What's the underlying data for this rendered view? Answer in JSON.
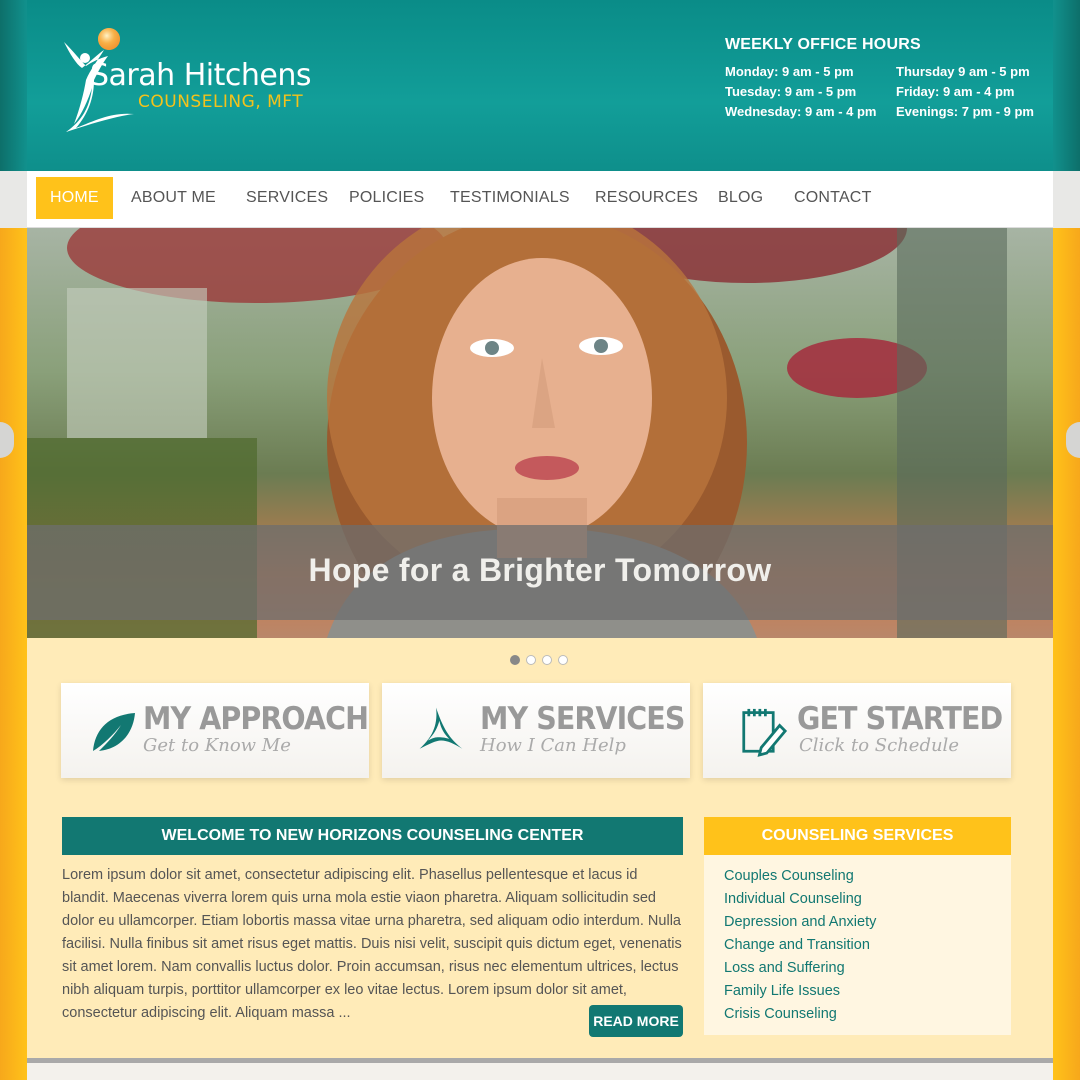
{
  "header": {
    "logo_name": "Sarah Hitchens",
    "logo_sub": "COUNSELING, MFT",
    "hours_title": "WEEKLY OFFICE HOURS",
    "hours": [
      "Monday: 9 am - 5 pm",
      "Thursday 9 am - 5 pm",
      "Tuesday: 9 am - 5 pm",
      "Friday: 9 am - 4 pm",
      "Wednesday: 9 am - 4 pm",
      "Evenings: 7 pm - 9 pm"
    ]
  },
  "nav": {
    "items": [
      "HOME",
      "ABOUT ME",
      "SERVICES",
      "POLICIES",
      "TESTIMONIALS",
      "RESOURCES",
      "BLOG",
      "CONTACT"
    ],
    "active": "HOME"
  },
  "hero": {
    "caption": "Hope for a Brighter Tomorrow",
    "slides": 4,
    "current_slide": 1
  },
  "promos": [
    {
      "title": "MY APPROACH",
      "subtitle": "Get to Know Me",
      "icon": "leaf-icon"
    },
    {
      "title": "MY SERVICES",
      "subtitle": "How I Can Help",
      "icon": "tripod-icon"
    },
    {
      "title": "GET STARTED",
      "subtitle": "Click to Schedule",
      "icon": "notepad-pencil-icon"
    }
  ],
  "welcome": {
    "title": "WELCOME TO NEW HORIZONS COUNSELING CENTER",
    "body": "Lorem ipsum dolor sit amet, consectetur adipiscing elit. Phasellus pellentesque et lacus id blandit. Maecenas viverra lorem quis urna mola estie viaon pharetra. Aliquam sollicitudin sed dolor eu ullamcorper. Etiam lobortis massa vitae urna pharetra, sed aliquam odio interdum. Nulla facilisi. Nulla finibus sit amet risus eget mattis. Duis nisi velit, suscipit quis dictum eget, venenatis sit amet lorem. Nam convallis luctus dolor. Proin accumsan, risus nec elementum ultrices, lectus nibh aliquam turpis, porttitor ullamcorper ex leo vitae lectus. Lorem ipsum dolor sit amet, consectetur adipiscing elit. Aliquam massa ...",
    "read_more": "READ MORE"
  },
  "services": {
    "title": "COUNSELING SERVICES",
    "items": [
      "Couples Counseling",
      "Individual Counseling",
      "Depression and Anxiety",
      "Change and Transition",
      "Loss and Suffering",
      "Family Life Issues",
      "Crisis Counseling"
    ]
  },
  "colors": {
    "teal": "#127872",
    "gold": "#ffc21a",
    "cream": "#ffebb8"
  }
}
